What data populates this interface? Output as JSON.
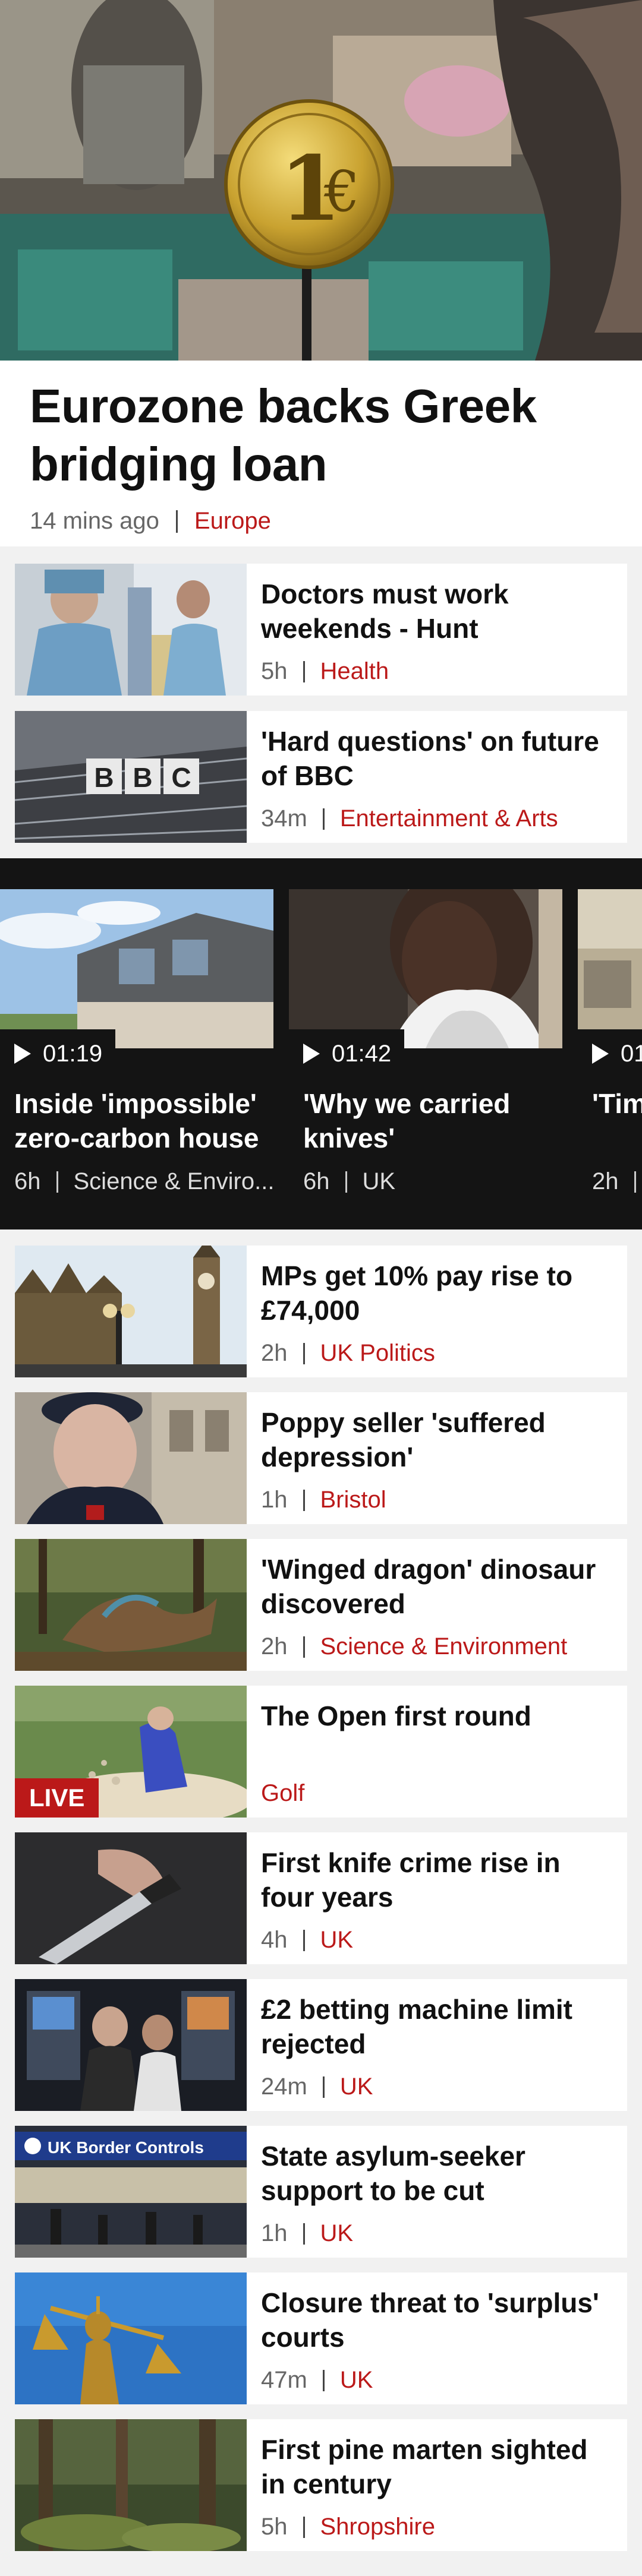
{
  "hero": {
    "image": "Euro coin sign above market stall",
    "title": "Eurozone backs Greek bridging loan",
    "time": "14 mins ago",
    "section": "Europe"
  },
  "top_stories": [
    {
      "title": "Doctors must work weekends - Hunt",
      "time": "5h",
      "section": "Health",
      "image": "doctors-in-hospital-corridor"
    },
    {
      "title": "'Hard questions' on future of BBC",
      "time": "34m",
      "section": "Entertainment & Arts",
      "image": "bbc-building-sign"
    }
  ],
  "videos": [
    {
      "duration": "01:19",
      "title": "Inside 'impossible' zero-carbon house",
      "time": "6h",
      "section": "Science & Enviro...",
      "image": "modern-house"
    },
    {
      "duration": "01:42",
      "title": "'Why we carried knives'",
      "time": "6h",
      "section": "UK",
      "image": "woman-portrait"
    },
    {
      "duration": "01",
      "title": "'Tim get",
      "time": "2h",
      "section": "",
      "image": "street-scene"
    }
  ],
  "stories": [
    {
      "title": "MPs get 10% pay rise to £74,000",
      "time": "2h",
      "section": "UK Politics",
      "image": "big-ben",
      "live": false
    },
    {
      "title": "Poppy seller 'suffered depression'",
      "time": "1h",
      "section": "Bristol",
      "image": "elderly-man",
      "live": false
    },
    {
      "title": "'Winged dragon' dinosaur discovered",
      "time": "2h",
      "section": "Science & Environment",
      "image": "feathered-dinosaur",
      "live": false
    },
    {
      "title": "The Open first round",
      "time": "",
      "section": "Golf",
      "image": "golfer-in-bunker",
      "live": true,
      "live_label": "LIVE"
    },
    {
      "title": "First knife crime rise in four years",
      "time": "4h",
      "section": "UK",
      "image": "hand-holding-knife",
      "live": false
    },
    {
      "title": "£2 betting machine limit rejected",
      "time": "24m",
      "section": "UK",
      "image": "betting-machines",
      "live": false
    },
    {
      "title": "State asylum-seeker support to be cut",
      "time": "1h",
      "section": "UK",
      "image": "uk-border-controls",
      "live": false,
      "sign_text": "UK Border Controls"
    },
    {
      "title": "Closure threat to 'surplus' courts",
      "time": "47m",
      "section": "UK",
      "image": "lady-justice-statue",
      "live": false
    },
    {
      "title": "First pine marten sighted in century",
      "time": "5h",
      "section": "Shropshire",
      "image": "forest",
      "live": false
    }
  ],
  "colors": {
    "accent": "#bb1919",
    "background": "#f1f1f1",
    "video_strip": "#141414"
  }
}
